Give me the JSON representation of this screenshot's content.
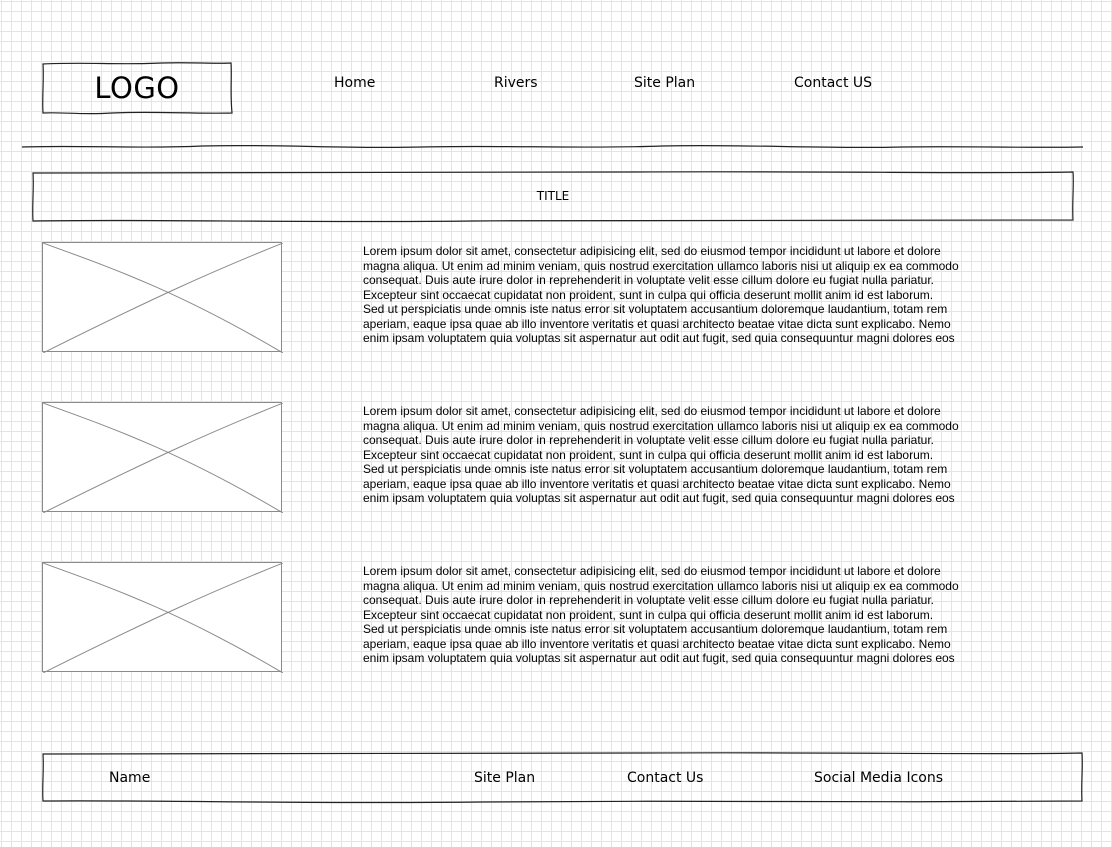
{
  "header": {
    "logo": "LOGO",
    "nav": [
      {
        "label": "Home"
      },
      {
        "label": "Rivers"
      },
      {
        "label": "Site Plan"
      },
      {
        "label": "Contact US"
      }
    ]
  },
  "title": "TITLE",
  "content": [
    {
      "image_icon": "image-placeholder-icon",
      "text": "Lorem ipsum dolor sit amet, consectetur adipisicing elit, sed do eiusmod tempor incididunt ut labore et dolore\nmagna aliqua. Ut enim ad minim veniam, quis nostrud exercitation ullamco laboris nisi ut aliquip ex ea commodo\nconsequat. Duis aute irure dolor in reprehenderit in voluptate velit esse cillum dolore eu fugiat nulla pariatur.\nExcepteur sint occaecat cupidatat non proident, sunt in culpa qui officia deserunt mollit anim id est laborum.\nSed ut perspiciatis unde omnis iste natus error sit voluptatem accusantium doloremque laudantium, totam rem\naperiam, eaque ipsa quae ab illo inventore veritatis et quasi architecto beatae vitae dicta sunt explicabo. Nemo\nenim ipsam voluptatem quia voluptas sit aspernatur aut odit aut fugit, sed quia consequuntur magni dolores eos"
    },
    {
      "image_icon": "image-placeholder-icon",
      "text": "Lorem ipsum dolor sit amet, consectetur adipisicing elit, sed do eiusmod tempor incididunt ut labore et dolore\nmagna aliqua. Ut enim ad minim veniam, quis nostrud exercitation ullamco laboris nisi ut aliquip ex ea commodo\nconsequat. Duis aute irure dolor in reprehenderit in voluptate velit esse cillum dolore eu fugiat nulla pariatur.\nExcepteur sint occaecat cupidatat non proident, sunt in culpa qui officia deserunt mollit anim id est laborum.\nSed ut perspiciatis unde omnis iste natus error sit voluptatem accusantium doloremque laudantium, totam rem\naperiam, eaque ipsa quae ab illo inventore veritatis et quasi architecto beatae vitae dicta sunt explicabo. Nemo\nenim ipsam voluptatem quia voluptas sit aspernatur aut odit aut fugit, sed quia consequuntur magni dolores eos"
    },
    {
      "image_icon": "image-placeholder-icon",
      "text": "Lorem ipsum dolor sit amet, consectetur adipisicing elit, sed do eiusmod tempor incididunt ut labore et dolore\nmagna aliqua. Ut enim ad minim veniam, quis nostrud exercitation ullamco laboris nisi ut aliquip ex ea commodo\nconsequat. Duis aute irure dolor in reprehenderit in voluptate velit esse cillum dolore eu fugiat nulla pariatur.\nExcepteur sint occaecat cupidatat non proident, sunt in culpa qui officia deserunt mollit anim id est laborum.\nSed ut perspiciatis unde omnis iste natus error sit voluptatem accusantium doloremque laudantium, totam rem\naperiam, eaque ipsa quae ab illo inventore veritatis et quasi architecto beatae vitae dicta sunt explicabo. Nemo\nenim ipsam voluptatem quia voluptas sit aspernatur aut odit aut fugit, sed quia consequuntur magni dolores eos"
    }
  ],
  "footer": {
    "name": "Name",
    "site_plan": "Site Plan",
    "contact": "Contact Us",
    "social": "Social Media Icons"
  },
  "colors": {
    "grid": "#e4e4e4",
    "stroke": "#222222",
    "placeholder_line": "#8a8a8a"
  }
}
